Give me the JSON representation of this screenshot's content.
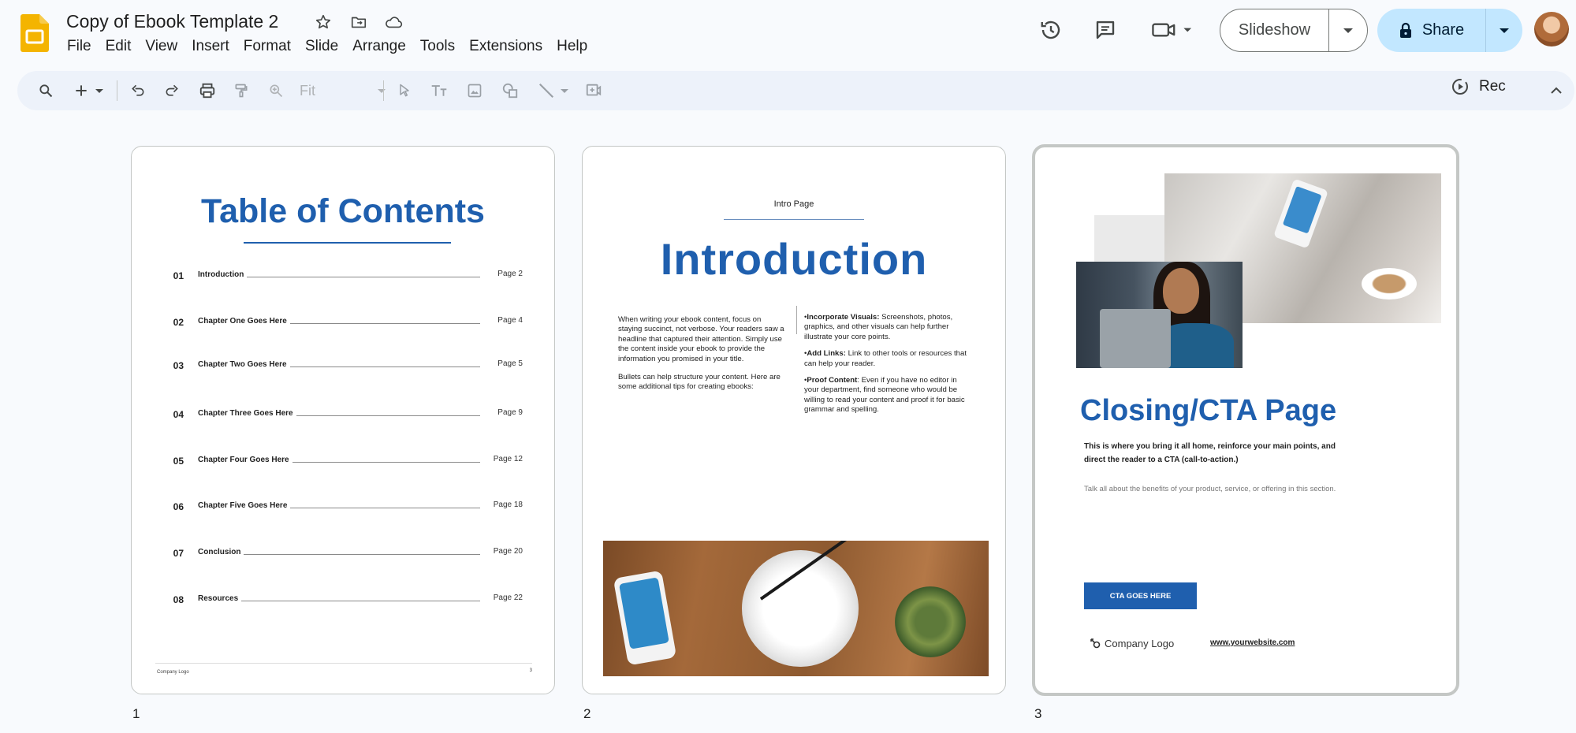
{
  "app": {
    "doc_title": "Copy of Ebook Template 2",
    "menu": [
      "File",
      "Edit",
      "View",
      "Insert",
      "Format",
      "Slide",
      "Arrange",
      "Tools",
      "Extensions",
      "Help"
    ],
    "brand_color": "#f4b400"
  },
  "header": {
    "slideshow_label": "Slideshow",
    "share_label": "Share",
    "share_color": "#c2e7ff"
  },
  "toolbar": {
    "zoom_value": "Fit",
    "rec_label": "Rec"
  },
  "slides": [
    {
      "number": "1",
      "title": "Table of Contents",
      "rows": [
        {
          "num": "01",
          "label": "Introduction",
          "page": "Page 2"
        },
        {
          "num": "02",
          "label": "Chapter One Goes Here",
          "page": "Page 4"
        },
        {
          "num": "03",
          "label": "Chapter Two Goes Here",
          "page": "Page 5"
        },
        {
          "num": "04",
          "label": "Chapter Three Goes Here",
          "page": "Page 9"
        },
        {
          "num": "05",
          "label": "Chapter Four Goes Here",
          "page": "Page 12"
        },
        {
          "num": "06",
          "label": "Chapter Five Goes Here",
          "page": "Page 18"
        },
        {
          "num": "07",
          "label": "Conclusion",
          "page": "Page 20"
        },
        {
          "num": "08",
          "label": "Resources",
          "page": "Page 22"
        }
      ],
      "footer_logo": "Company Logo",
      "footer_page": "3"
    },
    {
      "number": "2",
      "kicker": "Intro Page",
      "title": "Introduction",
      "left_p1": "When writing your ebook content, focus on staying succinct, not verbose. Your readers saw a headline that captured their attention. Simply use the content inside your ebook to provide the information you promised in your title.",
      "left_p2": "Bullets can help structure your content. Here are some additional tips for creating ebooks:",
      "bullets": [
        {
          "head": "Incorporate Visuals:",
          "text": " Screenshots, photos, graphics, and other visuals can help further illustrate your core points."
        },
        {
          "head": "Add Links:",
          "text": " Link to other tools or resources that can help your reader."
        },
        {
          "head": "Proof Content",
          "text": ": Even if you have no editor in your department, find someone who would be willing to read your content and proof it for basic grammar and spelling."
        }
      ]
    },
    {
      "number": "3",
      "title": "Closing/CTA Page",
      "lead": "This is where you bring it all home, reinforce your main points, and direct the reader to a CTA (call-to-action.)",
      "body": "Talk all about the benefits of your product, service, or offering in this section.",
      "cta_label": "CTA GOES HERE",
      "logo": "Company Logo",
      "url": "www.yourwebsite.com"
    }
  ],
  "colors": {
    "accent_blue": "#1f5fae",
    "canvas": "#f8fafd",
    "toolbar": "#edf2fa"
  }
}
